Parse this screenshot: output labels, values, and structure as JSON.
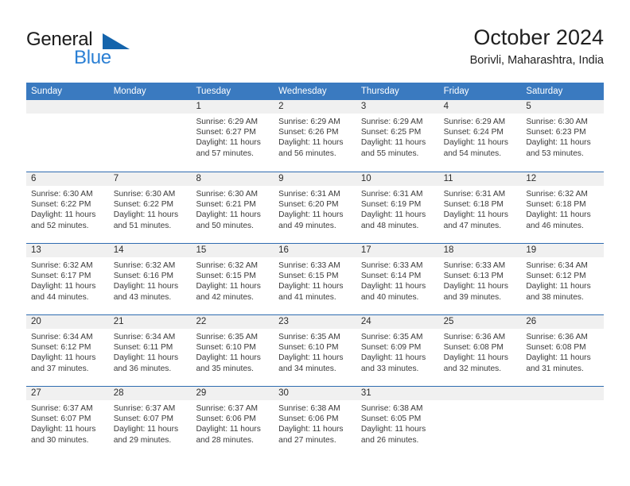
{
  "brand": {
    "word1": "General",
    "word2": "Blue",
    "triangle_color": "#1464ac",
    "blue_text_color": "#2a7fd4"
  },
  "header": {
    "title": "October 2024",
    "subtitle": "Borivli, Maharashtra, India"
  },
  "theme": {
    "header_blue": "#3a7ac0",
    "row_divider_blue": "#2f6cb0",
    "daynum_band": "#f0f0f0"
  },
  "weekdays": [
    "Sunday",
    "Monday",
    "Tuesday",
    "Wednesday",
    "Thursday",
    "Friday",
    "Saturday"
  ],
  "weeks": [
    [
      {
        "day": "",
        "empty": true,
        "sunrise": "",
        "sunset": "",
        "daylight": ""
      },
      {
        "day": "",
        "empty": true,
        "sunrise": "",
        "sunset": "",
        "daylight": ""
      },
      {
        "day": "1",
        "sunrise": "Sunrise: 6:29 AM",
        "sunset": "Sunset: 6:27 PM",
        "daylight": "Daylight: 11 hours and 57 minutes."
      },
      {
        "day": "2",
        "sunrise": "Sunrise: 6:29 AM",
        "sunset": "Sunset: 6:26 PM",
        "daylight": "Daylight: 11 hours and 56 minutes."
      },
      {
        "day": "3",
        "sunrise": "Sunrise: 6:29 AM",
        "sunset": "Sunset: 6:25 PM",
        "daylight": "Daylight: 11 hours and 55 minutes."
      },
      {
        "day": "4",
        "sunrise": "Sunrise: 6:29 AM",
        "sunset": "Sunset: 6:24 PM",
        "daylight": "Daylight: 11 hours and 54 minutes."
      },
      {
        "day": "5",
        "sunrise": "Sunrise: 6:30 AM",
        "sunset": "Sunset: 6:23 PM",
        "daylight": "Daylight: 11 hours and 53 minutes."
      }
    ],
    [
      {
        "day": "6",
        "sunrise": "Sunrise: 6:30 AM",
        "sunset": "Sunset: 6:22 PM",
        "daylight": "Daylight: 11 hours and 52 minutes."
      },
      {
        "day": "7",
        "sunrise": "Sunrise: 6:30 AM",
        "sunset": "Sunset: 6:22 PM",
        "daylight": "Daylight: 11 hours and 51 minutes."
      },
      {
        "day": "8",
        "sunrise": "Sunrise: 6:30 AM",
        "sunset": "Sunset: 6:21 PM",
        "daylight": "Daylight: 11 hours and 50 minutes."
      },
      {
        "day": "9",
        "sunrise": "Sunrise: 6:31 AM",
        "sunset": "Sunset: 6:20 PM",
        "daylight": "Daylight: 11 hours and 49 minutes."
      },
      {
        "day": "10",
        "sunrise": "Sunrise: 6:31 AM",
        "sunset": "Sunset: 6:19 PM",
        "daylight": "Daylight: 11 hours and 48 minutes."
      },
      {
        "day": "11",
        "sunrise": "Sunrise: 6:31 AM",
        "sunset": "Sunset: 6:18 PM",
        "daylight": "Daylight: 11 hours and 47 minutes."
      },
      {
        "day": "12",
        "sunrise": "Sunrise: 6:32 AM",
        "sunset": "Sunset: 6:18 PM",
        "daylight": "Daylight: 11 hours and 46 minutes."
      }
    ],
    [
      {
        "day": "13",
        "sunrise": "Sunrise: 6:32 AM",
        "sunset": "Sunset: 6:17 PM",
        "daylight": "Daylight: 11 hours and 44 minutes."
      },
      {
        "day": "14",
        "sunrise": "Sunrise: 6:32 AM",
        "sunset": "Sunset: 6:16 PM",
        "daylight": "Daylight: 11 hours and 43 minutes."
      },
      {
        "day": "15",
        "sunrise": "Sunrise: 6:32 AM",
        "sunset": "Sunset: 6:15 PM",
        "daylight": "Daylight: 11 hours and 42 minutes."
      },
      {
        "day": "16",
        "sunrise": "Sunrise: 6:33 AM",
        "sunset": "Sunset: 6:15 PM",
        "daylight": "Daylight: 11 hours and 41 minutes."
      },
      {
        "day": "17",
        "sunrise": "Sunrise: 6:33 AM",
        "sunset": "Sunset: 6:14 PM",
        "daylight": "Daylight: 11 hours and 40 minutes."
      },
      {
        "day": "18",
        "sunrise": "Sunrise: 6:33 AM",
        "sunset": "Sunset: 6:13 PM",
        "daylight": "Daylight: 11 hours and 39 minutes."
      },
      {
        "day": "19",
        "sunrise": "Sunrise: 6:34 AM",
        "sunset": "Sunset: 6:12 PM",
        "daylight": "Daylight: 11 hours and 38 minutes."
      }
    ],
    [
      {
        "day": "20",
        "sunrise": "Sunrise: 6:34 AM",
        "sunset": "Sunset: 6:12 PM",
        "daylight": "Daylight: 11 hours and 37 minutes."
      },
      {
        "day": "21",
        "sunrise": "Sunrise: 6:34 AM",
        "sunset": "Sunset: 6:11 PM",
        "daylight": "Daylight: 11 hours and 36 minutes."
      },
      {
        "day": "22",
        "sunrise": "Sunrise: 6:35 AM",
        "sunset": "Sunset: 6:10 PM",
        "daylight": "Daylight: 11 hours and 35 minutes."
      },
      {
        "day": "23",
        "sunrise": "Sunrise: 6:35 AM",
        "sunset": "Sunset: 6:10 PM",
        "daylight": "Daylight: 11 hours and 34 minutes."
      },
      {
        "day": "24",
        "sunrise": "Sunrise: 6:35 AM",
        "sunset": "Sunset: 6:09 PM",
        "daylight": "Daylight: 11 hours and 33 minutes."
      },
      {
        "day": "25",
        "sunrise": "Sunrise: 6:36 AM",
        "sunset": "Sunset: 6:08 PM",
        "daylight": "Daylight: 11 hours and 32 minutes."
      },
      {
        "day": "26",
        "sunrise": "Sunrise: 6:36 AM",
        "sunset": "Sunset: 6:08 PM",
        "daylight": "Daylight: 11 hours and 31 minutes."
      }
    ],
    [
      {
        "day": "27",
        "sunrise": "Sunrise: 6:37 AM",
        "sunset": "Sunset: 6:07 PM",
        "daylight": "Daylight: 11 hours and 30 minutes."
      },
      {
        "day": "28",
        "sunrise": "Sunrise: 6:37 AM",
        "sunset": "Sunset: 6:07 PM",
        "daylight": "Daylight: 11 hours and 29 minutes."
      },
      {
        "day": "29",
        "sunrise": "Sunrise: 6:37 AM",
        "sunset": "Sunset: 6:06 PM",
        "daylight": "Daylight: 11 hours and 28 minutes."
      },
      {
        "day": "30",
        "sunrise": "Sunrise: 6:38 AM",
        "sunset": "Sunset: 6:06 PM",
        "daylight": "Daylight: 11 hours and 27 minutes."
      },
      {
        "day": "31",
        "sunrise": "Sunrise: 6:38 AM",
        "sunset": "Sunset: 6:05 PM",
        "daylight": "Daylight: 11 hours and 26 minutes."
      },
      {
        "day": "",
        "empty": true,
        "sunrise": "",
        "sunset": "",
        "daylight": ""
      },
      {
        "day": "",
        "empty": true,
        "sunrise": "",
        "sunset": "",
        "daylight": ""
      }
    ]
  ]
}
